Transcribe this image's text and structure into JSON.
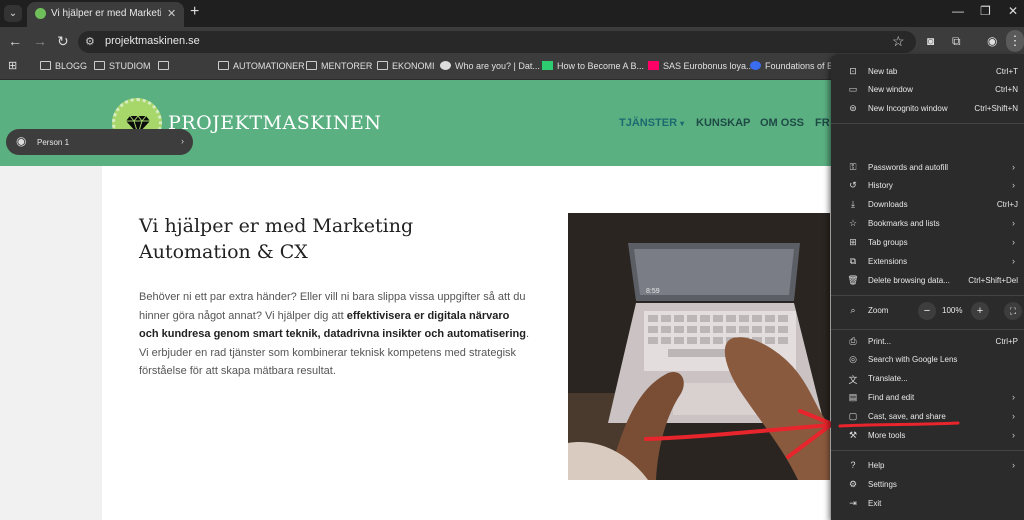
{
  "tab": {
    "title": "Vi hjälper er med Marketing Au",
    "close": "✕",
    "new_tab": "+"
  },
  "toolbar": {
    "url": "projektmaskinen.se"
  },
  "bookmarks": [
    "BLOGG",
    "STUDIOM",
    "AUTOMATIONER",
    "MENTORER",
    "EKONOMI",
    "Who are you? | Dat...",
    "How to Become A B...",
    "SAS Eurobonus loya...",
    "Foundations of Bu"
  ],
  "site": {
    "logo_text": "PROJEKTMASKINEN",
    "nav": [
      "TJÄNSTER",
      "KUNSKAP",
      "OM OSS",
      "FR"
    ],
    "hero_title": "Vi hjälper er med Marketing Automation & CX",
    "hero_p1_a": "Behöver ni ett par extra händer? Eller vill ni bara slippa vissa uppgifter så att du hinner göra något annat? Vi hjälper dig att ",
    "hero_p1_b": "effektivisera er digitala närvaro och kundresa genom smart teknik, datadrivna insikter och automatisering",
    "hero_p1_c": ".",
    "hero_p2": "Vi erbjuder en rad tjänster som kombinerar teknisk kompetens med strategisk förståelse för att skapa mätbara resultat.",
    "screen_time": "8:59"
  },
  "menu": {
    "new_tab": "New tab",
    "new_tab_sc": "Ctrl+T",
    "new_window": "New window",
    "new_window_sc": "Ctrl+N",
    "incognito": "New Incognito window",
    "incognito_sc": "Ctrl+Shift+N",
    "person": "Person 1",
    "passwords": "Passwords and autofill",
    "history": "History",
    "downloads": "Downloads",
    "downloads_sc": "Ctrl+J",
    "bookmarks": "Bookmarks and lists",
    "tab_groups": "Tab groups",
    "extensions": "Extensions",
    "delete": "Delete browsing data...",
    "delete_sc": "Ctrl+Shift+Del",
    "zoom": "Zoom",
    "zoom_value": "100%",
    "print": "Print...",
    "print_sc": "Ctrl+P",
    "lens": "Search with Google Lens",
    "translate": "Translate...",
    "find_edit": "Find and edit",
    "cast_save_share": "Cast, save, and share",
    "more_tools": "More tools",
    "help": "Help",
    "settings": "Settings",
    "exit": "Exit"
  },
  "colors": {
    "header_green": "#5bb082",
    "annotation_red": "#e8242c",
    "menu_bg": "#2b2b2b"
  }
}
